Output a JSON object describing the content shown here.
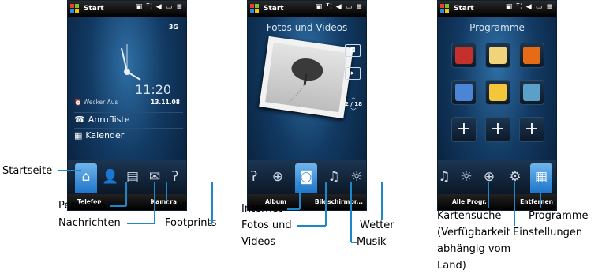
{
  "status_title": "Start",
  "status_icons": "▣ ᵀ⫶ ◀ ▭ ≡",
  "phone1": {
    "network": "3G",
    "time": "11:20",
    "alarm": "Wecker Aus",
    "date": "13.11.08",
    "item_calls": "Anrufliste",
    "item_calendar": "Kalender",
    "softkey_left": "Telefon",
    "softkey_right": "Kamera"
  },
  "phone2": {
    "title": "Fotos und Videos",
    "counter": "2 / 18",
    "softkey_left": "Album",
    "softkey_right": "Bildschirmpr..."
  },
  "phone3": {
    "title": "Programme",
    "softkey_left": "Alle Progr.",
    "softkey_right": "Entfernen"
  },
  "callouts": {
    "startseite": "Startseite",
    "personen": "Personen",
    "nachrichten": "Nachrichten",
    "mail": "Mail",
    "footprints": "Footprints",
    "internet": "Internet",
    "fotos_videos_1": "Fotos und",
    "fotos_videos_2": "Videos",
    "musik": "Musik",
    "wetter": "Wetter",
    "kartensuche_1": "Kartensuche",
    "kartensuche_2": "(Verfügbarkeit",
    "kartensuche_3": "abhängig vom",
    "kartensuche_4": "Land)",
    "einstellungen": "Einstellungen",
    "programme": "Programme"
  },
  "colors": {
    "accent": "#1f86c8",
    "tab_selected": "#3b93dd"
  }
}
